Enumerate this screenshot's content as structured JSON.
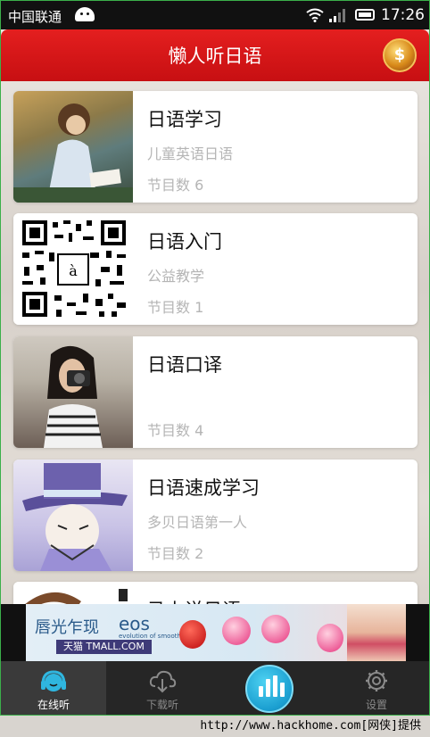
{
  "status_bar": {
    "carrier": "中国联通",
    "time": "17:26",
    "icons": [
      "android-icon",
      "wifi-icon",
      "signal-icon",
      "battery-icon"
    ]
  },
  "header": {
    "title": "懒人听日语",
    "coin_symbol": "$",
    "accent_color": "#d5161a"
  },
  "programs": [
    {
      "title": "日语学习",
      "subtitle": "儿童英语日语",
      "count": "节目数 6"
    },
    {
      "title": "日语入门",
      "subtitle": "公益教学",
      "count": "节目数 1"
    },
    {
      "title": "日语口译",
      "subtitle": "",
      "count": "节目数 4"
    },
    {
      "title": "日语速成学习",
      "subtitle": "多贝日语第一人",
      "count": "节目数 2"
    },
    {
      "title": "马上说日语",
      "subtitle": "",
      "count": ""
    }
  ],
  "ad": {
    "headline": "唇光乍现",
    "brand": "eos",
    "brand_tagline": "evolution of smooth",
    "store": "天猫 TMALL.COM"
  },
  "nav": {
    "online": "在线听",
    "download": "下载听",
    "settings": "设置"
  },
  "footer": {
    "watermark": "http://www.hackhome.com[网侠]提供"
  }
}
